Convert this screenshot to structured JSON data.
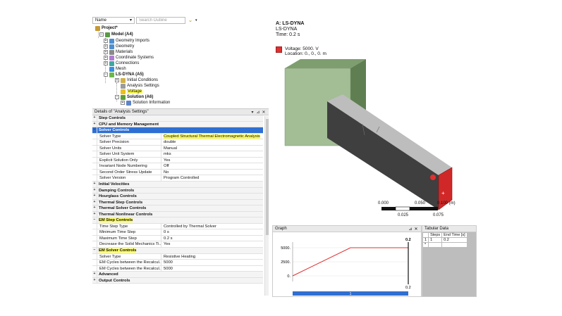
{
  "outline": {
    "name_dropdown": "Name",
    "search_placeholder": "Search Outline",
    "tree": {
      "project": "Project*",
      "model": "Model (A4)",
      "geometry_imports": "Geometry Imports",
      "geometry": "Geometry",
      "materials": "Materials",
      "coordinate_systems": "Coordinate Systems",
      "connections": "Connections",
      "mesh": "Mesh",
      "analysis": "LS-DYNA (A5)",
      "initial_conditions": "Initial Conditions",
      "analysis_settings": "Analysis Settings",
      "voltage": "Voltage",
      "solution": "Solution (A6)",
      "solution_information": "Solution Information"
    }
  },
  "details": {
    "title": "Details of \"Analysis Settings\"",
    "controls": {
      "pin": "▾",
      "pushpin": "⊿",
      "close": "✕"
    },
    "categories": {
      "step": "Step Controls",
      "cpu": "CPU and Memory Management",
      "solver": "Solver Controls",
      "initial_velocities": "Initial Velocities",
      "damping": "Damping Controls",
      "hourglass": "Hourglass Controls",
      "thermal_step": "Thermal Step Controls",
      "thermal_solver": "Thermal Solver Controls",
      "thermal_nonlinear": "Thermal Nonlinear Controls",
      "em_step": "EM Step Controls",
      "em_solver": "EM Solver Controls",
      "advanced": "Advanced",
      "output": "Output Controls"
    },
    "solver_rows": [
      {
        "k": "Solver Type",
        "v": "Coupled Structural Thermal Electromagnetic Analysis"
      },
      {
        "k": "Solver Precision",
        "v": "double"
      },
      {
        "k": "Solver Units",
        "v": "Manual"
      },
      {
        "k": "Solver Unit System",
        "v": "mks"
      },
      {
        "k": "Explicit Solution Only",
        "v": "Yes"
      },
      {
        "k": "Invariant Node Numbering",
        "v": "Off"
      },
      {
        "k": "Second Order Stress Update",
        "v": "No"
      },
      {
        "k": "Solver Version",
        "v": "Program Controlled"
      }
    ],
    "em_step_rows": [
      {
        "k": "Time Step Type",
        "v": "Controlled by Thermal Solver"
      },
      {
        "k": "Minimum Time Step",
        "v": "0 s"
      },
      {
        "k": "Maximum Time Step",
        "v": "0.2 s"
      },
      {
        "k": "Decrease the Solid Mechanics Ti...",
        "v": "Yes"
      }
    ],
    "em_solver_rows": [
      {
        "k": "Solver Type",
        "v": "Resistive Heating"
      },
      {
        "k": "EM Cycles between the Recalcul...",
        "v": "5000"
      },
      {
        "k": "EM Cycles between the Recalcul...",
        "v": "5000"
      }
    ]
  },
  "viewport": {
    "title": "A: LS-DYNA",
    "subtitle": "LS-DYNA",
    "time": "Time: 0.2 s",
    "legend_label": "Voltage: 5000. V",
    "legend_location": "Location: 0., 0., 0. m",
    "legend_color": "#e03030",
    "scale": {
      "t0": "0.000",
      "t1": "0.050",
      "t2": "0.100 (m)",
      "b1": "0.025",
      "b2": "0.075"
    }
  },
  "graph": {
    "title": "Graph",
    "y_ticks": [
      "5000.",
      "2500.",
      "0."
    ],
    "x_end_label": "0.2",
    "top_label": "0.2",
    "bar_label": "1",
    "series_color": "#e03030",
    "chart_data": {
      "type": "line",
      "x": [
        0,
        0.1,
        0.2
      ],
      "y": [
        0,
        5000,
        5000
      ],
      "xlim": [
        0,
        0.2
      ],
      "ylim": [
        -1000,
        6000
      ]
    }
  },
  "tabular": {
    "title": "Tabular Data",
    "headers": [
      "Steps",
      "End Time [s]"
    ],
    "rows": [
      [
        "1",
        "1",
        "0.2"
      ]
    ],
    "new_row_marker": "*"
  }
}
